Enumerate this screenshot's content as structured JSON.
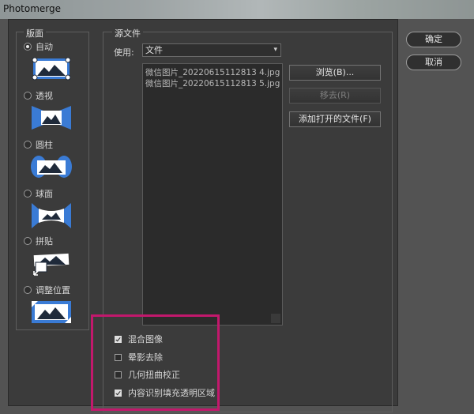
{
  "window": {
    "title": "Photomerge"
  },
  "layout": {
    "legend": "版面",
    "options": [
      {
        "label": "自动",
        "checked": true,
        "thumb": "auto-layout-icon"
      },
      {
        "label": "透视",
        "checked": false,
        "thumb": "perspective-layout-icon"
      },
      {
        "label": "圆柱",
        "checked": false,
        "thumb": "cylindrical-layout-icon"
      },
      {
        "label": "球面",
        "checked": false,
        "thumb": "spherical-layout-icon"
      },
      {
        "label": "拼贴",
        "checked": false,
        "thumb": "collage-layout-icon"
      },
      {
        "label": "调整位置",
        "checked": false,
        "thumb": "reposition-layout-icon"
      }
    ]
  },
  "source": {
    "legend": "源文件",
    "use_label": "使用:",
    "use_value": "文件",
    "files": [
      "微信图片_20220615112813 4.jpg",
      "微信图片_20220615112813 5.jpg"
    ],
    "browse_label": "浏览(B)...",
    "remove_label": "移去(R)",
    "add_open_label": "添加打开的文件(F)"
  },
  "options": [
    {
      "label": "混合图像",
      "checked": true
    },
    {
      "label": "晕影去除",
      "checked": false
    },
    {
      "label": "几何扭曲校正",
      "checked": false
    },
    {
      "label": "内容识别填充透明区域",
      "checked": true
    }
  ],
  "actions": {
    "ok_label": "确定",
    "cancel_label": "取消"
  },
  "colors": {
    "thumb_blue": "#3a7bd5",
    "highlight": "#c2186c"
  }
}
